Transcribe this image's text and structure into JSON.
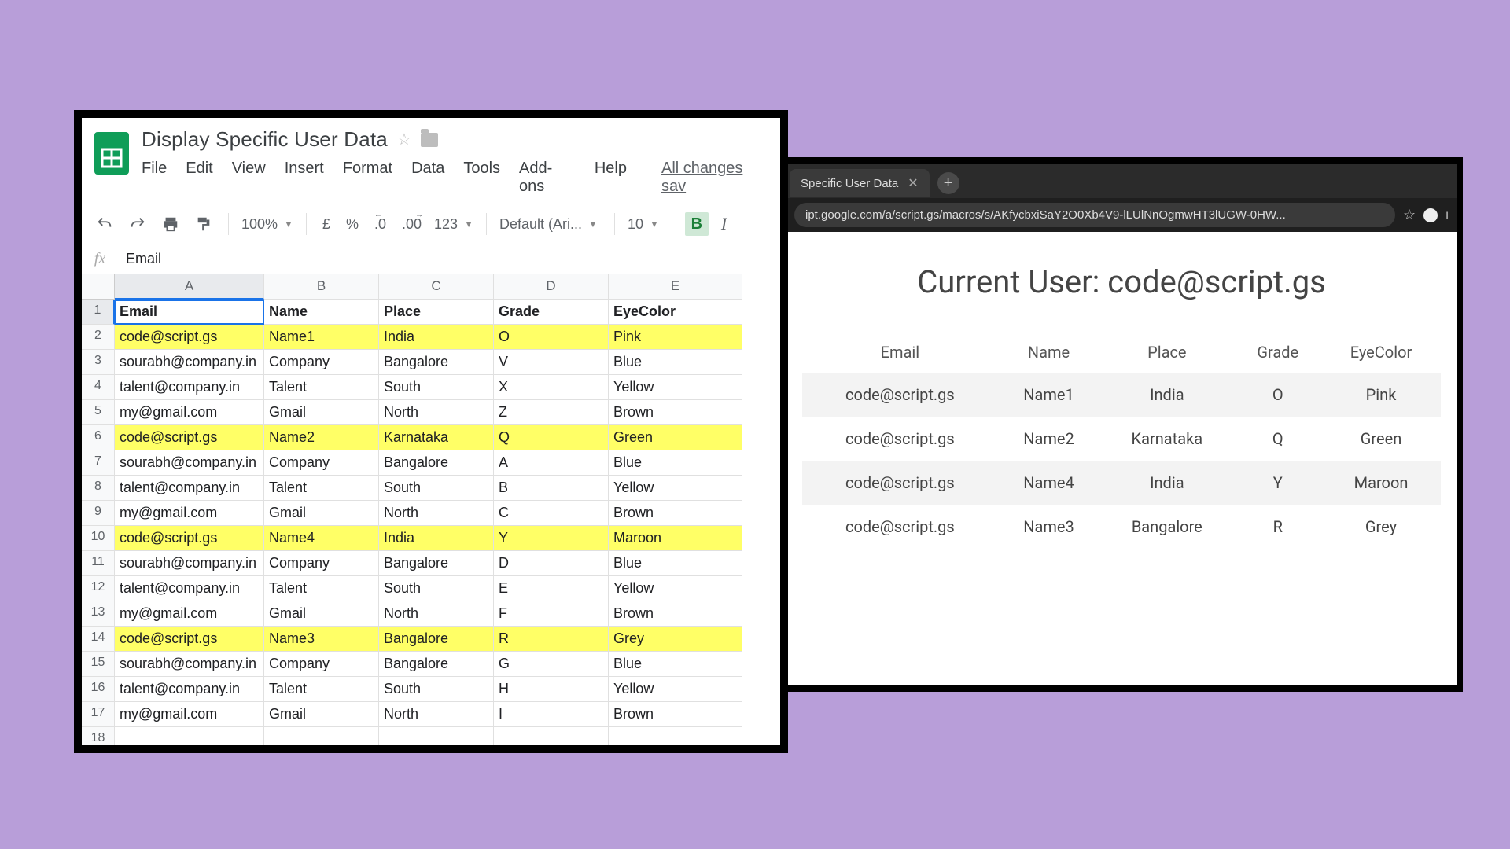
{
  "sheets": {
    "title": "Display Specific User Data",
    "menu": [
      "File",
      "Edit",
      "View",
      "Insert",
      "Format",
      "Data",
      "Tools",
      "Add-ons",
      "Help"
    ],
    "changes_saved": "All changes sav",
    "zoom": "100%",
    "currency": "£",
    "percent": "%",
    "dec_dec": ".0",
    "dec_inc": ".00",
    "num_format": "123",
    "font": "Default (Ari...",
    "font_size": "10",
    "formula_value": "Email",
    "columns": [
      "A",
      "B",
      "C",
      "D",
      "E"
    ],
    "headers": [
      "Email",
      "Name",
      "Place",
      "Grade",
      "EyeColor"
    ],
    "rows": [
      {
        "n": 2,
        "hl": true,
        "c": [
          "code@script.gs",
          "Name1",
          "India",
          "O",
          "Pink"
        ]
      },
      {
        "n": 3,
        "hl": false,
        "c": [
          "sourabh@company.in",
          "Company",
          "Bangalore",
          "V",
          "Blue"
        ]
      },
      {
        "n": 4,
        "hl": false,
        "c": [
          "talent@company.in",
          "Talent",
          "South",
          "X",
          "Yellow"
        ]
      },
      {
        "n": 5,
        "hl": false,
        "c": [
          "my@gmail.com",
          "Gmail",
          "North",
          "Z",
          "Brown"
        ]
      },
      {
        "n": 6,
        "hl": true,
        "c": [
          "code@script.gs",
          "Name2",
          "Karnataka",
          "Q",
          "Green"
        ]
      },
      {
        "n": 7,
        "hl": false,
        "c": [
          "sourabh@company.in",
          "Company",
          "Bangalore",
          "A",
          "Blue"
        ]
      },
      {
        "n": 8,
        "hl": false,
        "c": [
          "talent@company.in",
          "Talent",
          "South",
          "B",
          "Yellow"
        ]
      },
      {
        "n": 9,
        "hl": false,
        "c": [
          "my@gmail.com",
          "Gmail",
          "North",
          "C",
          "Brown"
        ]
      },
      {
        "n": 10,
        "hl": true,
        "c": [
          "code@script.gs",
          "Name4",
          "India",
          "Y",
          "Maroon"
        ]
      },
      {
        "n": 11,
        "hl": false,
        "c": [
          "sourabh@company.in",
          "Company",
          "Bangalore",
          "D",
          "Blue"
        ]
      },
      {
        "n": 12,
        "hl": false,
        "c": [
          "talent@company.in",
          "Talent",
          "South",
          "E",
          "Yellow"
        ]
      },
      {
        "n": 13,
        "hl": false,
        "c": [
          "my@gmail.com",
          "Gmail",
          "North",
          "F",
          "Brown"
        ]
      },
      {
        "n": 14,
        "hl": true,
        "c": [
          "code@script.gs",
          "Name3",
          "Bangalore",
          "R",
          "Grey"
        ]
      },
      {
        "n": 15,
        "hl": false,
        "c": [
          "sourabh@company.in",
          "Company",
          "Bangalore",
          "G",
          "Blue"
        ]
      },
      {
        "n": 16,
        "hl": false,
        "c": [
          "talent@company.in",
          "Talent",
          "South",
          "H",
          "Yellow"
        ]
      },
      {
        "n": 17,
        "hl": false,
        "c": [
          "my@gmail.com",
          "Gmail",
          "North",
          "I",
          "Brown"
        ]
      }
    ],
    "extra_row": 18
  },
  "browser": {
    "tab_title": "Specific User Data",
    "url": "ipt.google.com/a/script.gs/macros/s/AKfycbxiSaY2O0Xb4V9-lLUlNnOgmwHT3lUGW-0HW...",
    "heading_prefix": "Current User: ",
    "heading_user": "code@script.gs",
    "headers": [
      "Email",
      "Name",
      "Place",
      "Grade",
      "EyeColor"
    ],
    "rows": [
      [
        "code@script.gs",
        "Name1",
        "India",
        "O",
        "Pink"
      ],
      [
        "code@script.gs",
        "Name2",
        "Karnataka",
        "Q",
        "Green"
      ],
      [
        "code@script.gs",
        "Name4",
        "India",
        "Y",
        "Maroon"
      ],
      [
        "code@script.gs",
        "Name3",
        "Bangalore",
        "R",
        "Grey"
      ]
    ]
  }
}
